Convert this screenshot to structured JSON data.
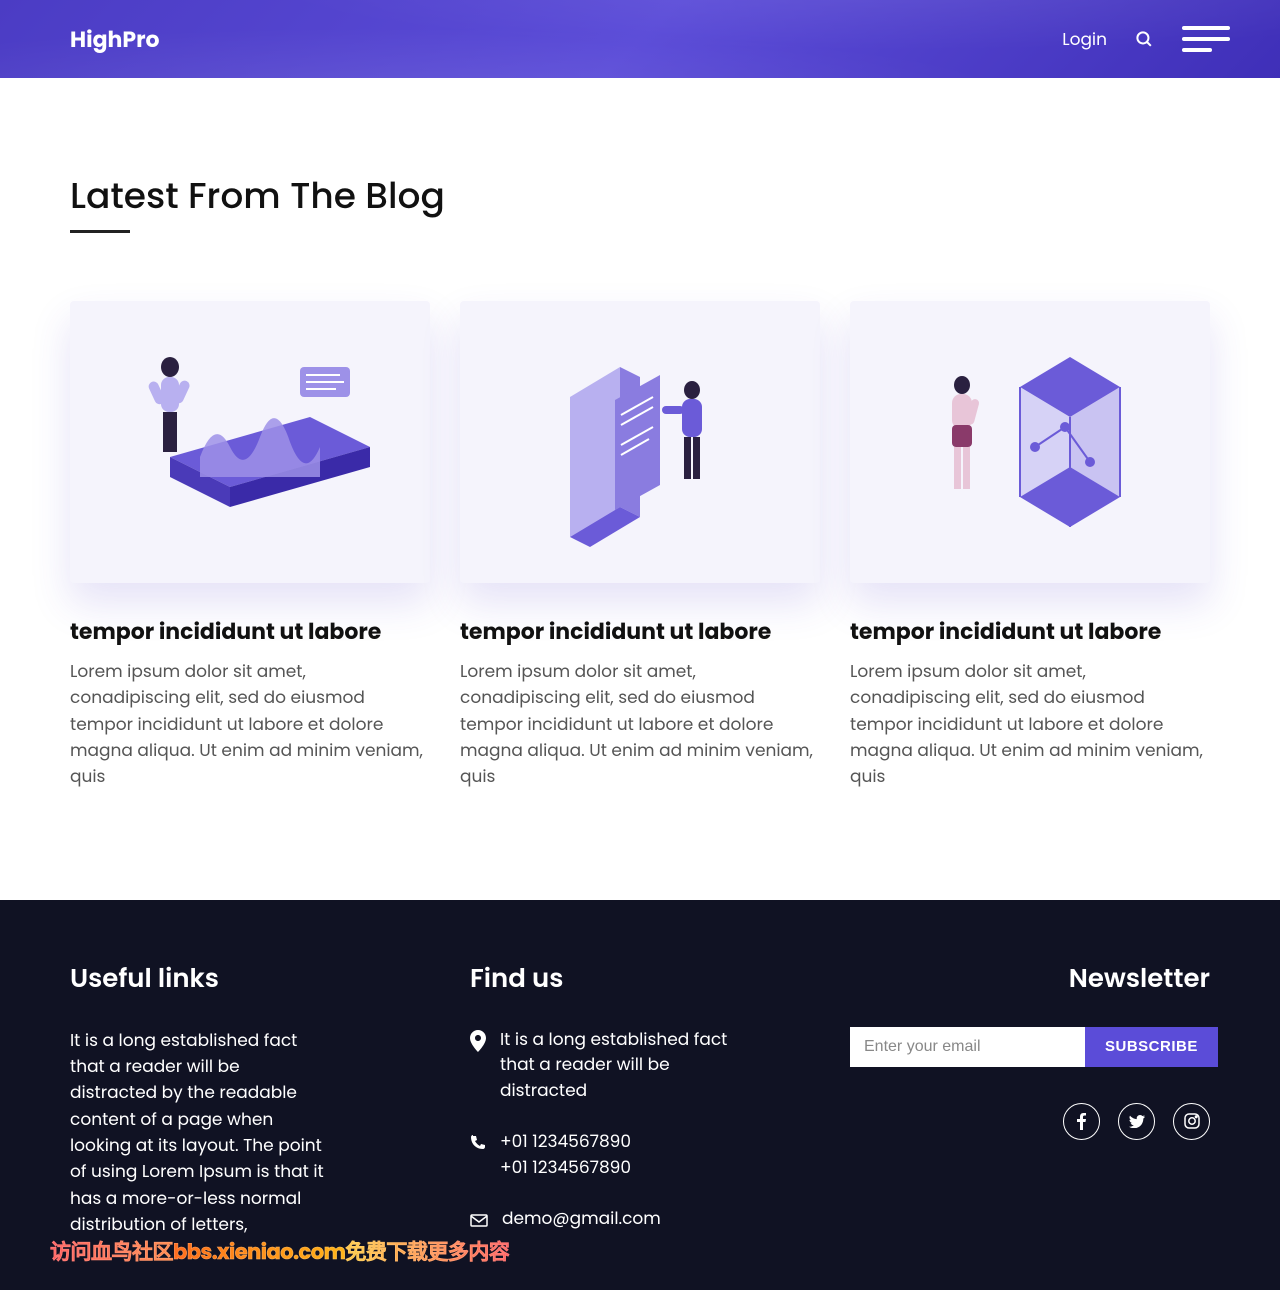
{
  "header": {
    "brand": "HighPro",
    "login": "Login"
  },
  "blog": {
    "heading": "Latest From The Blog",
    "cards": [
      {
        "title": "tempor incididunt ut labore",
        "text": "Lorem ipsum dolor sit amet, conadipiscing elit, sed do eiusmod tempor incididunt ut labore et dolore magna aliqua. Ut enim ad minim veniam, quis"
      },
      {
        "title": "tempor incididunt ut labore",
        "text": "Lorem ipsum dolor sit amet, conadipiscing elit, sed do eiusmod tempor incididunt ut labore et dolore magna aliqua. Ut enim ad minim veniam, quis"
      },
      {
        "title": "tempor incididunt ut labore",
        "text": "Lorem ipsum dolor sit amet, conadipiscing elit, sed do eiusmod tempor incididunt ut labore et dolore magna aliqua. Ut enim ad minim veniam, quis"
      }
    ]
  },
  "footer": {
    "useful": {
      "title": "Useful links",
      "text": "It is a long established fact that a reader will be distracted by the readable content of a page when looking at its layout. The point of using Lorem Ipsum is that it has a more-or-less normal distribution of letters,"
    },
    "find": {
      "title": "Find us",
      "address": "It is a long established fact that a reader will be distracted",
      "phone1": "+01 1234567890",
      "phone2": "+01 1234567890",
      "email": "demo@gmail.com"
    },
    "newsletter": {
      "title": "Newsletter",
      "placeholder": "Enter your email",
      "button": "SUBSCRIBE"
    }
  },
  "watermark": "访问血鸟社区bbs.xieniao.com免费下载更多内容"
}
